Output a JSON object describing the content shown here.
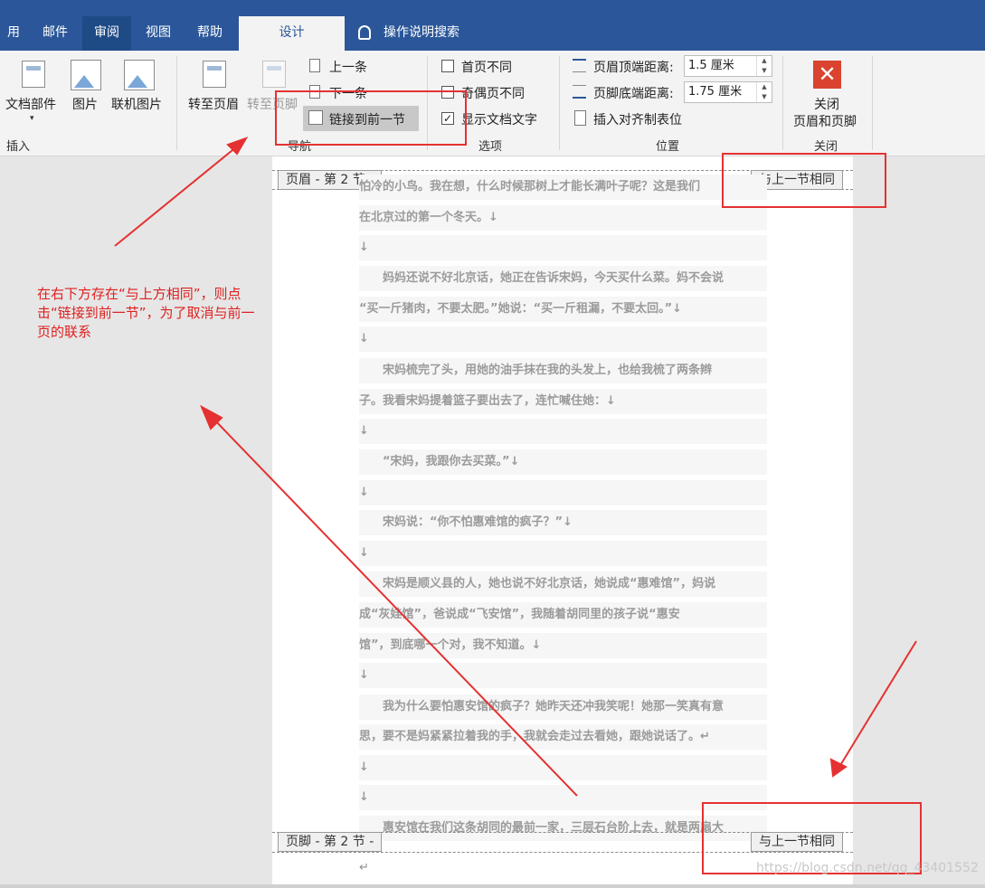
{
  "tabs": {
    "partial": "用",
    "mail": "邮件",
    "review": "审阅",
    "view": "视图",
    "help": "帮助",
    "design": "设计",
    "tell_me": "操作说明搜索"
  },
  "ribbon": {
    "insert": {
      "doc_parts": "文档部件",
      "picture": "图片",
      "online_picture": "联机图片",
      "group_label": "插入"
    },
    "navigation": {
      "goto_header": "转至页眉",
      "goto_footer": "转至页脚",
      "previous": "上一条",
      "next": "下一条",
      "link_previous": "链接到前一节",
      "group_label": "导航"
    },
    "options": {
      "diff_first": "首页不同",
      "diff_odd_even": "奇偶页不同",
      "show_doc_text": "显示文档文字",
      "show_doc_text_checked": "✓",
      "group_label": "选项"
    },
    "position": {
      "header_top_label": "页眉顶端距离:",
      "header_top_value": "1.5 厘米",
      "footer_bottom_label": "页脚底端距离:",
      "footer_bottom_value": "1.75 厘米",
      "insert_align_tab": "插入对齐制表位",
      "group_label": "位置"
    },
    "close": {
      "line1": "关闭",
      "line2": "页眉和页脚",
      "group_label": "关闭"
    }
  },
  "document": {
    "header_tag": "页眉 - 第 2 节 -",
    "footer_tag": "页脚 - 第 2 节 -",
    "same_as_previous": "与上一节相同",
    "lines": [
      "怕冷的小鸟。我在想，什么时候那树上才能长满叶子呢？这是我们",
      "在北京过的第一个冬天。↓",
      "↓",
      "　　妈妈还说不好北京话，她正在告诉宋妈，今天买什么菜。妈不会说",
      "“买一斤猪肉，不要太肥。”她说：“买一斤租漏，不要太回。”↓",
      "↓",
      "　　宋妈梳完了头，用她的油手抹在我的头发上，也给我梳了两条辫",
      "子。我看宋妈提着篮子要出去了，连忙喊住她：↓",
      "↓",
      "　　“宋妈，我跟你去买菜。”↓",
      "↓",
      "　　宋妈说：“你不怕惠难馆的疯子？”↓",
      "↓",
      "　　宋妈是顺义县的人，她也说不好北京话，她说成“惠难馆”，妈说",
      "成“灰娃馆”，爸说成“飞安馆”，我随着胡同里的孩子说“惠安",
      "馆”，到底哪一个对，我不知道。↓",
      "↓",
      "　　我为什么要怕惠安馆的疯子？她昨天还冲我笑呢！她那一笑真有意",
      "思，要不是妈紧紧拉着我的手，我就会走过去看她，跟她说话了。↵",
      "↓",
      "↓",
      "　　惠安馆在我们这条胡同的最前一家，三层石台阶上去，就是两扇大"
    ],
    "footer_mark": "↵"
  },
  "annotation": {
    "note": "在右下方存在“与上方相同”，则点击“链接到前一节”，为了取消与前一页的联系"
  },
  "watermark": "https://blog.csdn.net/qq_43401552",
  "colors": {
    "title_bar": "#2b579a",
    "ribbon": "#f3f3f3",
    "annotation": "#e53131"
  }
}
